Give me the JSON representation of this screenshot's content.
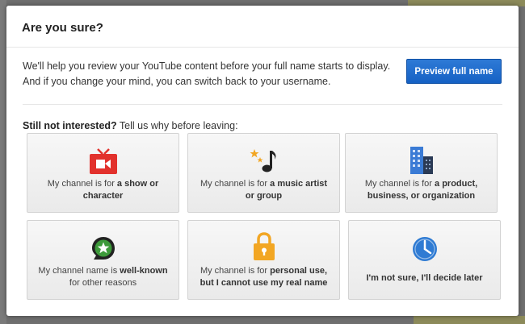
{
  "dialog": {
    "title": "Are you sure?",
    "intro_line1": "We'll help you review your YouTube content before your full name starts to display.",
    "intro_line2": "And if you change your mind, you can switch back to your username.",
    "preview_button": "Preview full name",
    "question_bold": "Still not interested?",
    "question_rest": " Tell us why before leaving:"
  },
  "options": [
    {
      "pre": "My channel is for ",
      "bold": "a show or character",
      "post": "",
      "icon": "tv-icon",
      "color": "#e2312c"
    },
    {
      "pre": "My channel is for ",
      "bold": "a music artist or group",
      "post": "",
      "icon": "music-note-icon",
      "color": "#222222"
    },
    {
      "pre": "My channel is for ",
      "bold": "a product, business, or organization",
      "post": "",
      "icon": "building-icon",
      "color": "#3a7bd5"
    },
    {
      "pre": "My channel name is ",
      "bold": "well-known",
      "post": " for other reasons",
      "icon": "star-badge-icon",
      "color": "#3d9a3a"
    },
    {
      "pre": "My channel is for ",
      "bold": "personal use, but I cannot use my real name",
      "post": "",
      "icon": "padlock-icon",
      "color": "#f2a623"
    },
    {
      "pre": "",
      "bold": "I'm not sure, I'll decide later",
      "post": "",
      "icon": "clock-icon",
      "color": "#2f7bd3"
    }
  ]
}
